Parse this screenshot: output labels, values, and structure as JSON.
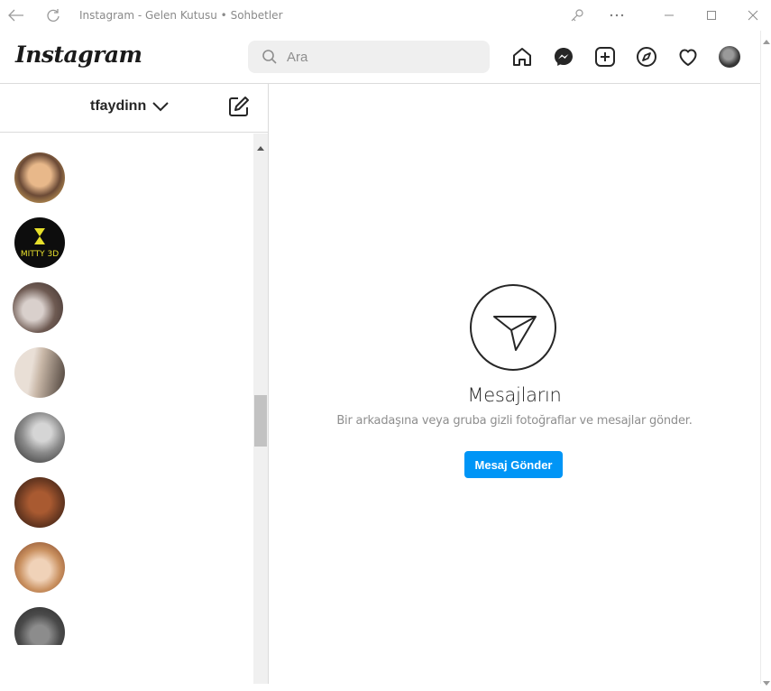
{
  "window": {
    "title": "Instagram - Gelen Kutusu • Sohbetler",
    "controls": [
      "back-arrow-icon",
      "refresh-icon",
      "key-icon",
      "more-icon",
      "minimize-icon",
      "maximize-icon",
      "close-icon"
    ]
  },
  "header": {
    "logo": "Instagram",
    "search_placeholder": "Ara",
    "nav_icons": [
      "home-icon",
      "messenger-icon",
      "new-post-icon",
      "explore-icon",
      "activity-heart-icon",
      "profile-avatar"
    ]
  },
  "sidebar": {
    "username": "tfaydinn",
    "threads": [
      {
        "name": "thread-1",
        "colors": [
          "#f5c76a",
          "#6b4a36",
          "#e8b88a"
        ]
      },
      {
        "name": "thread-2",
        "logo_text": "MITTY 3D",
        "colors": [
          "#0d0d0d",
          "#e7e02b"
        ]
      },
      {
        "name": "thread-3",
        "colors": [
          "#6e5a52",
          "#d9d0cc",
          "#3b2f2d"
        ]
      },
      {
        "name": "thread-4",
        "colors": [
          "#c9b8a8",
          "#4a3f38",
          "#e9dfd6"
        ]
      },
      {
        "name": "thread-5",
        "colors": [
          "#2b2b2b",
          "#8a8a8a",
          "#d5d5d5"
        ]
      },
      {
        "name": "thread-6",
        "colors": [
          "#6e3b22",
          "#a95a31",
          "#2a1a12"
        ]
      },
      {
        "name": "thread-7",
        "colors": [
          "#c9905f",
          "#7a3e24",
          "#f0d2b8"
        ]
      },
      {
        "name": "thread-8",
        "colors": [
          "#4a4a4a",
          "#8c8c8c",
          "#2a2a2a"
        ]
      }
    ]
  },
  "main": {
    "title": "Mesajların",
    "subtitle": "Bir arkadaşına veya gruba gizli fotoğraflar ve mesajlar gönder.",
    "button_label": "Mesaj Gönder"
  },
  "colors": {
    "accent": "#0095f6",
    "border": "#dbdbdb",
    "search_bg": "#efefef",
    "text_secondary": "#8e8e8e"
  }
}
